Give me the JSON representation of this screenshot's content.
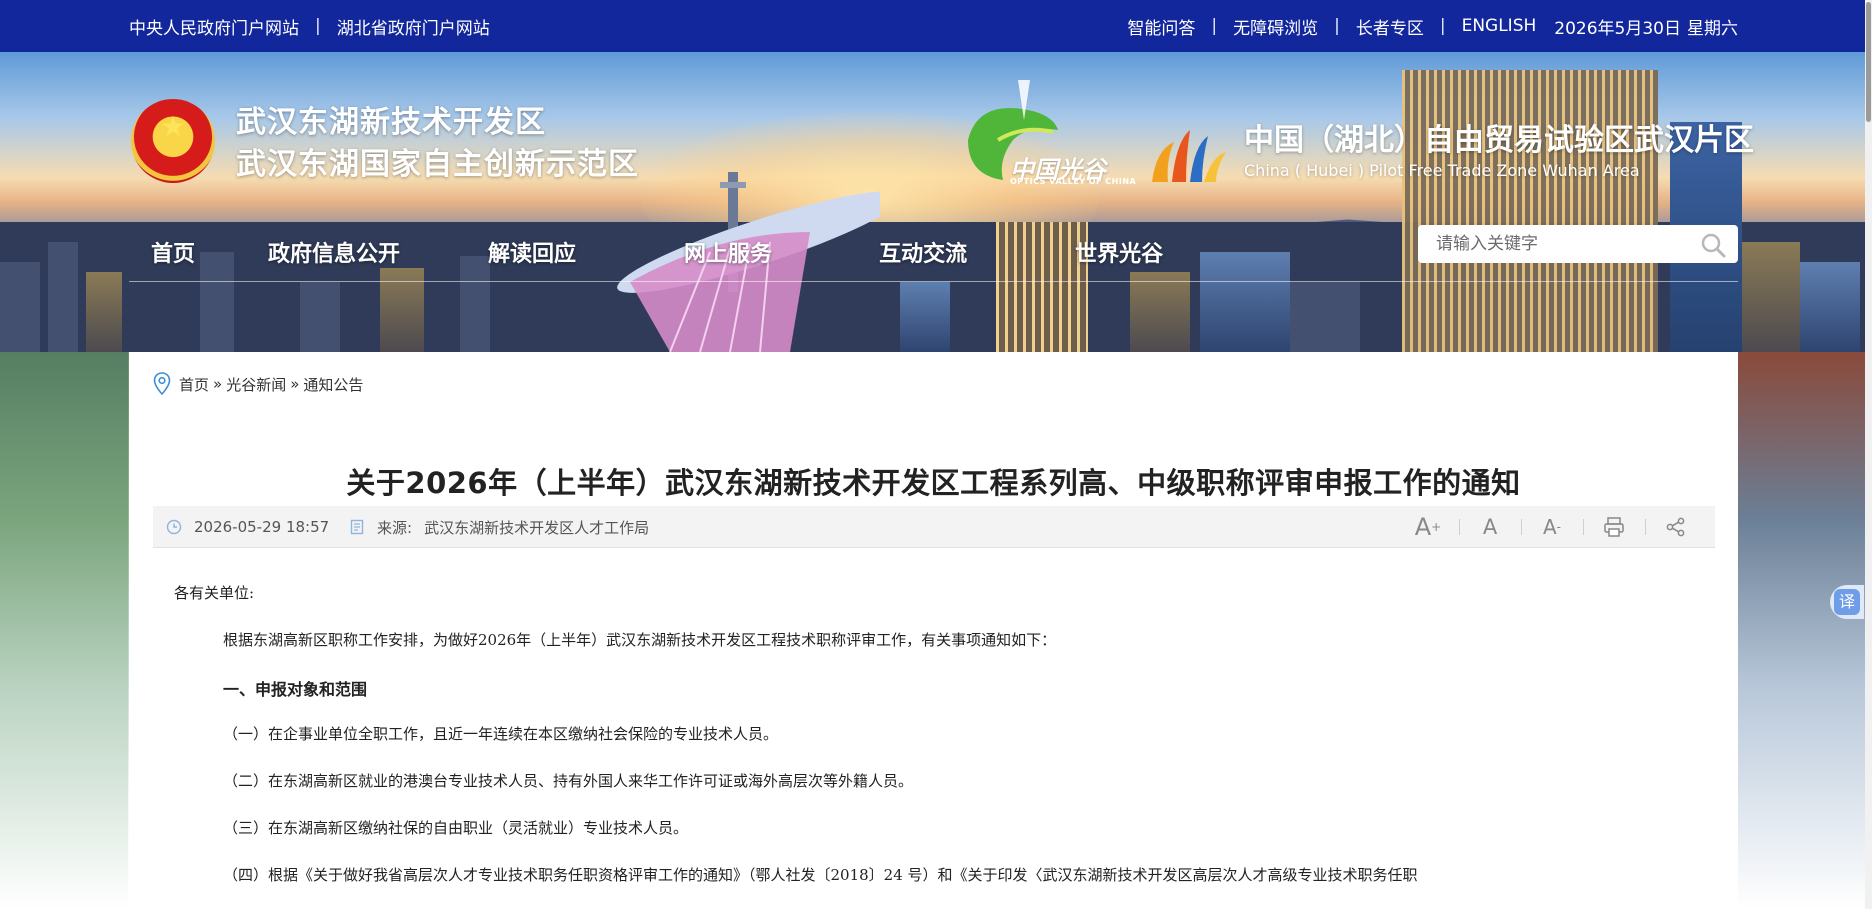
{
  "topbar": {
    "left_links": [
      "中央人民政府门户网站",
      "湖北省政府门户网站"
    ],
    "right_links": [
      "智能问答",
      "无障碍浏览",
      "长者专区",
      "ENGLISH"
    ],
    "separator": "|",
    "date": "2026年5月30日",
    "weekday": "星期六"
  },
  "header": {
    "zone_line1": "武汉东湖新技术开发区",
    "zone_line2": "武汉东湖国家自主创新示范区",
    "ovc_name": "中国光谷",
    "ovc_en": "OPTICS VALLEY OF CHINA",
    "ftz_cn": "中国（湖北）自由贸易试验区武汉片区",
    "ftz_en": "China ( Hubei ) Pilot Free Trade Zone Wuhan Area"
  },
  "nav": {
    "items": [
      "首页",
      "政府信息公开",
      "解读回应",
      "网上服务",
      "互动交流",
      "世界光谷"
    ]
  },
  "search": {
    "placeholder": "请输入关键字"
  },
  "breadcrumb": {
    "items": [
      "首页",
      "光谷新闻",
      "通知公告"
    ],
    "separator": "»"
  },
  "article": {
    "title": "关于2026年（上半年）武汉东湖新技术开发区工程系列高、中级职称评审申报工作的通知",
    "published": "2026-05-29 18:57",
    "source_label": "来源:",
    "source": "武汉东湖新技术开发区人才工作局",
    "tools": {
      "font_large": "A",
      "font_large_mark": "+",
      "font_default": "A",
      "font_small": "A",
      "font_small_mark": "-"
    },
    "salutation": "各有关单位:",
    "intro": "根据东湖高新区职称工作安排，为做好2026年（上半年）武汉东湖新技术开发区工程技术职称评审工作，有关事项通知如下：",
    "section1": "一、申报对象和范围",
    "items": [
      "（一）在企事业单位全职工作，且近一年连续在本区缴纳社会保险的专业技术人员。",
      "（二）在东湖高新区就业的港澳台专业技术人员、持有外国人来华工作许可证或海外高层次等外籍人员。",
      "（三）在东湖高新区缴纳社保的自由职业（灵活就业）专业技术人员。",
      "（四）根据《关于做好我省高层次人才专业技术职务任职资格评审工作的通知》（鄂人社发〔2018〕24 号）和《关于印发〈武汉东湖新技术开发区高层次人才高级专业技术职务任职"
    ]
  },
  "translate": {
    "label": "译"
  },
  "colors": {
    "topbar": "#13279c",
    "accent_blue": "#6f9de8"
  }
}
